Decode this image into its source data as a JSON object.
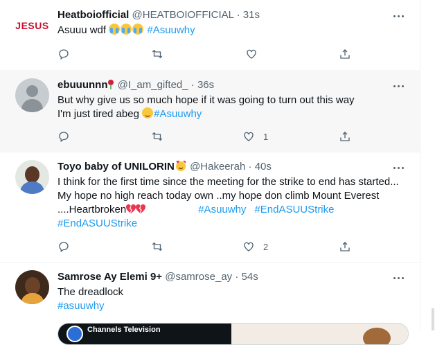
{
  "tweets": [
    {
      "name": "Heatboiofficial",
      "handle": "@HEATBOIOFFICIAL",
      "time": "31s",
      "avatar_text": "JESUS",
      "text_plain": "Asuuu wdf",
      "hashtags": [
        "#Asuuwhy"
      ],
      "replies": "",
      "retweets": "",
      "likes": "",
      "colors": {
        "avatar_text": "#c8102e"
      }
    },
    {
      "name": "ebuuunnn",
      "handle": "@I_am_gifted_",
      "time": "36s",
      "line1": "But why give us so much hope if it was going to turn out this way",
      "line2": "I'm just tired abeg",
      "hashtags": [
        "#Asuuwhy"
      ],
      "replies": "",
      "retweets": "",
      "likes": "1"
    },
    {
      "name": "Toyo baby of UNILORIN",
      "handle": "@Hakeerah",
      "time": "40s",
      "line1": "I think for the first time since the meeting for the strike to end has started...",
      "line2": "My hope no high reach today own ..my hope don climb Mount Everest",
      "line3": "....Heartbroken",
      "hashtags": [
        "#Asuuwhy",
        "#EndASUUStrike",
        "#EndASUUStrike"
      ],
      "replies": "",
      "retweets": "",
      "likes": "2"
    },
    {
      "name": "Samrose Ay Elemi 9+",
      "handle": "@samrose_ay",
      "time": "54s",
      "line1": "The dreadlock",
      "hashtags": [
        "#asuuwhy"
      ],
      "media": {
        "channel_name": "Channels Television"
      }
    }
  ],
  "separator": "·",
  "colors": {
    "accent": "#1d9bf0",
    "muted": "#536471",
    "hover_bg": "#f7f7f7"
  },
  "icons": [
    "reply-icon",
    "retweet-icon",
    "like-icon",
    "share-icon",
    "more-icon"
  ]
}
